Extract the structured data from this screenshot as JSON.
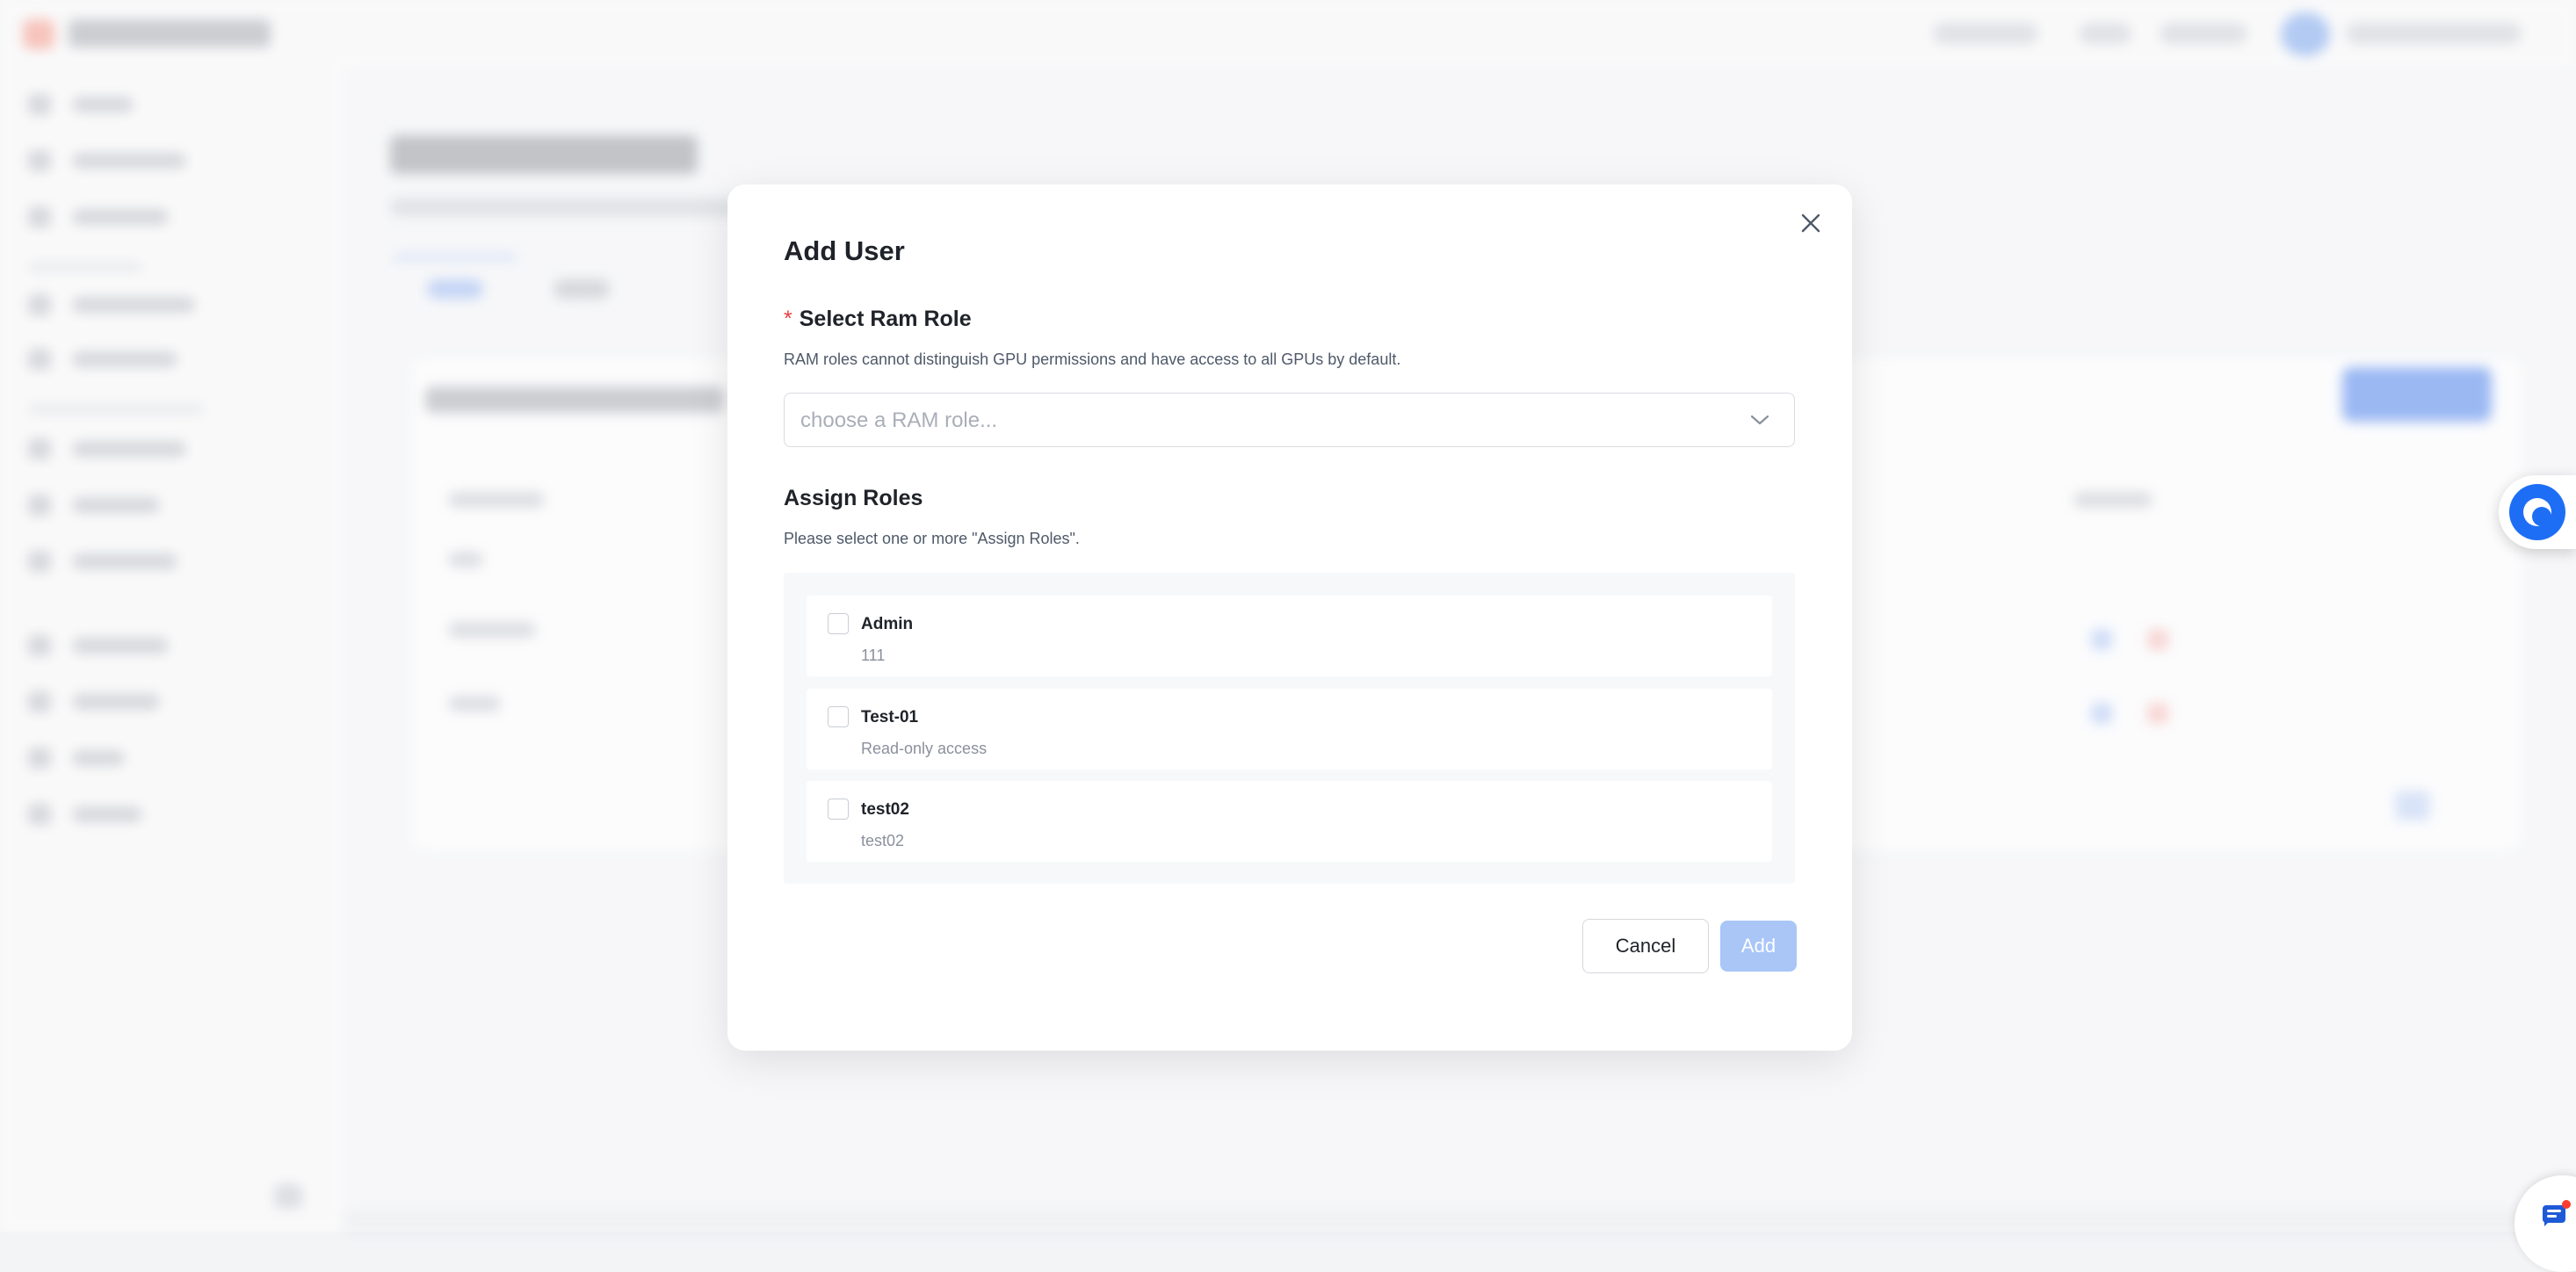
{
  "modal": {
    "title": "Add User",
    "ram_role": {
      "required_mark": "*",
      "label": "Select Ram Role",
      "hint": "RAM roles cannot distinguish GPU permissions and have access to all GPUs by default.",
      "placeholder": "choose a RAM role..."
    },
    "assign_roles": {
      "label": "Assign Roles",
      "hint": "Please select one or more \"Assign Roles\".",
      "items": [
        {
          "name": "Admin",
          "description": "111",
          "checked": false
        },
        {
          "name": "Test-01",
          "description": "Read-only access",
          "checked": false
        },
        {
          "name": "test02",
          "description": "test02",
          "checked": false
        }
      ]
    },
    "cancel_label": "Cancel",
    "add_label": "Add",
    "add_disabled": true
  },
  "colors": {
    "primary": "#1e6ef5",
    "add_disabled": "#a9c6f7",
    "required": "#e8403f"
  },
  "icons": {
    "close": "close-icon",
    "dropdown": "chevron-down-icon",
    "floating_assistant": "assistant-icon",
    "chat": "chat-icon"
  }
}
